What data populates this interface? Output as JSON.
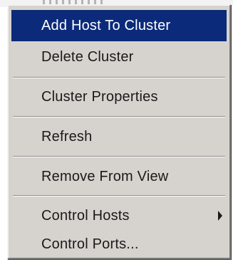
{
  "menu": {
    "items": [
      {
        "label": "Add Host To Cluster",
        "selected": true
      },
      {
        "label": "Delete Cluster"
      },
      {
        "label": "Cluster Properties"
      },
      {
        "label": "Refresh"
      },
      {
        "label": "Remove From View"
      },
      {
        "label": "Control Hosts",
        "has_submenu": true
      },
      {
        "label": "Control Ports..."
      }
    ]
  },
  "colors": {
    "menu_background": "#d6d3ce",
    "selection_background": "#0b2a7a",
    "selection_text": "#ffffff",
    "text": "#1a1a1a"
  }
}
